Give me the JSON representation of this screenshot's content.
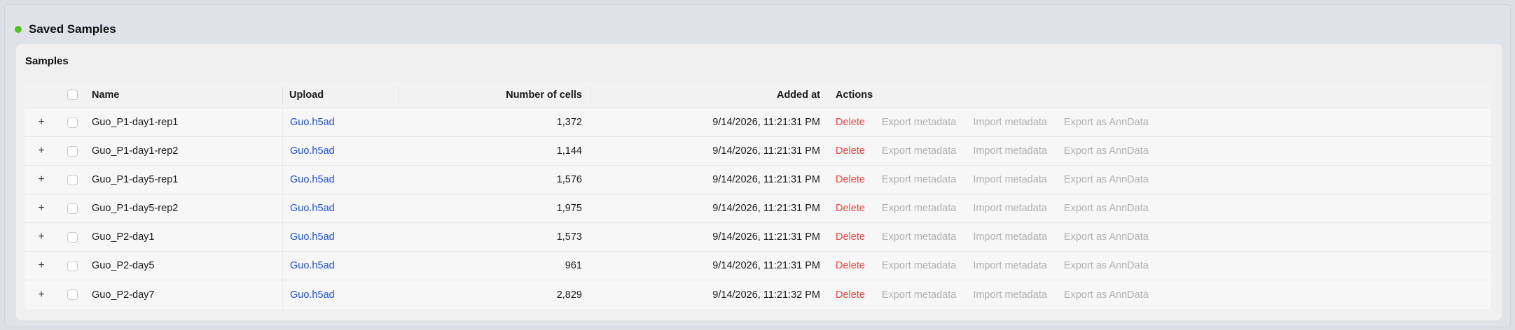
{
  "section": {
    "title": "Saved Samples",
    "status_color": "#52c41a"
  },
  "card": {
    "title": "Samples"
  },
  "table": {
    "columns": {
      "name": "Name",
      "upload": "Upload",
      "cells": "Number of cells",
      "added": "Added at",
      "actions": "Actions"
    },
    "action_labels": {
      "delete": "Delete",
      "export_metadata": "Export metadata",
      "import_metadata": "Import metadata",
      "export_anndata": "Export as AnnData"
    },
    "rows": [
      {
        "expand": "+",
        "name": "Guo_P1-day1-rep1",
        "upload": "Guo.h5ad",
        "cells": "1,372",
        "added": "9/14/2026, 11:21:31 PM"
      },
      {
        "expand": "+",
        "name": "Guo_P1-day1-rep2",
        "upload": "Guo.h5ad",
        "cells": "1,144",
        "added": "9/14/2026, 11:21:31 PM"
      },
      {
        "expand": "+",
        "name": "Guo_P1-day5-rep1",
        "upload": "Guo.h5ad",
        "cells": "1,576",
        "added": "9/14/2026, 11:21:31 PM"
      },
      {
        "expand": "+",
        "name": "Guo_P1-day5-rep2",
        "upload": "Guo.h5ad",
        "cells": "1,975",
        "added": "9/14/2026, 11:21:31 PM"
      },
      {
        "expand": "+",
        "name": "Guo_P2-day1",
        "upload": "Guo.h5ad",
        "cells": "1,573",
        "added": "9/14/2026, 11:21:31 PM"
      },
      {
        "expand": "+",
        "name": "Guo_P2-day5",
        "upload": "Guo.h5ad",
        "cells": "961",
        "added": "9/14/2026, 11:21:31 PM"
      },
      {
        "expand": "+",
        "name": "Guo_P2-day7",
        "upload": "Guo.h5ad",
        "cells": "2,829",
        "added": "9/14/2026, 11:21:32 PM"
      }
    ]
  }
}
